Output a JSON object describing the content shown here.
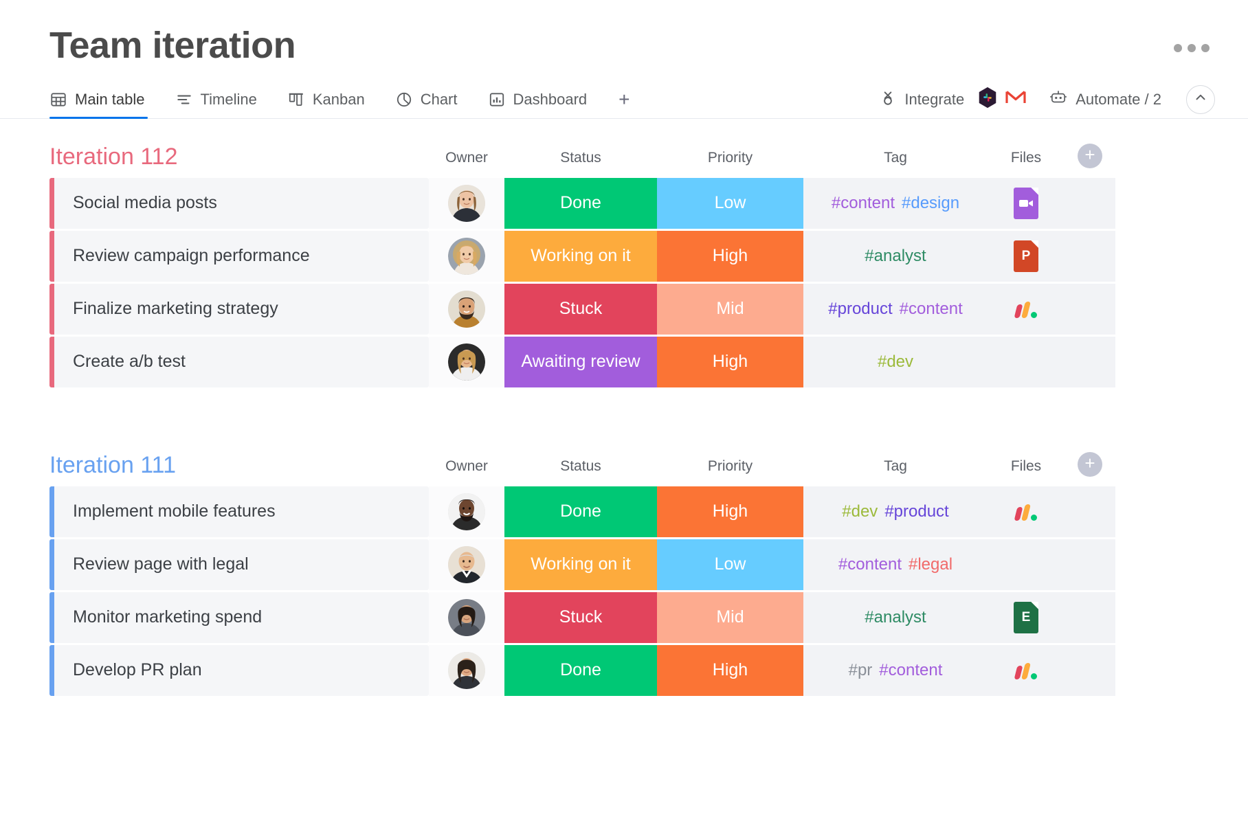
{
  "header": {
    "title": "Team iteration",
    "overflow_menu": "..."
  },
  "tabs": [
    {
      "label": "Main table",
      "icon": "table-icon",
      "active": true
    },
    {
      "label": "Timeline",
      "icon": "timeline-icon",
      "active": false
    },
    {
      "label": "Kanban",
      "icon": "kanban-icon",
      "active": false
    },
    {
      "label": "Chart",
      "icon": "chart-pie-icon",
      "active": false
    },
    {
      "label": "Dashboard",
      "icon": "dashboard-bars-icon",
      "active": false
    }
  ],
  "add_view_label": "+",
  "tools": {
    "integrate_label": "Integrate",
    "automate_label": "Automate / 2",
    "integration_apps": [
      "slack-icon",
      "gmail-icon"
    ],
    "collapse_label": "chevron-up-icon"
  },
  "columns": [
    "Owner",
    "Status",
    "Priority",
    "Tag",
    "Files"
  ],
  "add_column_label": "+",
  "colors": {
    "done": "#00c875",
    "working_on_it": "#fdab3d",
    "stuck": "#e2445c",
    "awaiting_review": "#a25ddc",
    "high": "#fb7435",
    "mid": "#fdab8f",
    "low": "#66ccff",
    "group_112": "#e8697d",
    "group_111": "#68a1f0",
    "tag_content": "#a25ddc",
    "tag_design": "#579bfc",
    "tag_analyst": "#2e8b64",
    "tag_product": "#6645d9",
    "tag_dev": "#9cba3b",
    "tag_legal": "#f16a6a",
    "tag_pr": "#8a8f98",
    "accent": "#0073ea"
  },
  "groups": [
    {
      "title": "Iteration 112",
      "color": "#e8697d",
      "rows": [
        {
          "name": "Social media posts",
          "owner": "avatar-woman-blonde",
          "status": "Done",
          "status_color": "#00c875",
          "priority": "Low",
          "priority_color": "#66ccff",
          "tags": [
            {
              "text": "#content",
              "color": "#a25ddc"
            },
            {
              "text": "#design",
              "color": "#579bfc"
            }
          ],
          "file": {
            "type": "video-file-icon",
            "color": "#a25ddc",
            "label": ""
          }
        },
        {
          "name": "Review campaign performance",
          "owner": "avatar-woman-curly",
          "status": "Working on it",
          "status_color": "#fdab3d",
          "priority": "High",
          "priority_color": "#fb7435",
          "tags": [
            {
              "text": "#analyst",
              "color": "#2e8b64"
            }
          ],
          "file": {
            "type": "powerpoint-file-icon",
            "color": "#d24726",
            "label": "P"
          }
        },
        {
          "name": "Finalize marketing strategy",
          "owner": "avatar-man-beard",
          "status": "Stuck",
          "status_color": "#e2445c",
          "priority": "Mid",
          "priority_color": "#fdab8f",
          "tags": [
            {
              "text": "#product",
              "color": "#6645d9"
            },
            {
              "text": "#content",
              "color": "#a25ddc"
            }
          ],
          "file": {
            "type": "monday-logo-icon",
            "color": "",
            "label": ""
          }
        },
        {
          "name": "Create a/b test",
          "owner": "avatar-woman-long-hair",
          "status": "Awaiting review",
          "status_color": "#a25ddc",
          "priority": "High",
          "priority_color": "#fb7435",
          "tags": [
            {
              "text": "#dev",
              "color": "#9cba3b"
            }
          ],
          "file": null
        }
      ]
    },
    {
      "title": "Iteration 111",
      "color": "#68a1f0",
      "rows": [
        {
          "name": "Implement mobile features",
          "owner": "avatar-man-dark-beard",
          "status": "Done",
          "status_color": "#00c875",
          "priority": "High",
          "priority_color": "#fb7435",
          "tags": [
            {
              "text": "#dev",
              "color": "#9cba3b"
            },
            {
              "text": "#product",
              "color": "#6645d9"
            }
          ],
          "file": {
            "type": "monday-logo-icon",
            "color": "",
            "label": ""
          }
        },
        {
          "name": "Review page with legal",
          "owner": "avatar-man-bald",
          "status": "Working on it",
          "status_color": "#fdab3d",
          "priority": "Low",
          "priority_color": "#66ccff",
          "tags": [
            {
              "text": "#content",
              "color": "#a25ddc"
            },
            {
              "text": "#legal",
              "color": "#f16a6a"
            }
          ],
          "file": null
        },
        {
          "name": "Monitor marketing spend",
          "owner": "avatar-woman-dark-hair",
          "status": "Stuck",
          "status_color": "#e2445c",
          "priority": "Mid",
          "priority_color": "#fdab8f",
          "tags": [
            {
              "text": "#analyst",
              "color": "#2e8b64"
            }
          ],
          "file": {
            "type": "excel-file-icon",
            "color": "#1e7145",
            "label": "E"
          }
        },
        {
          "name": "Develop PR plan",
          "owner": "avatar-woman-dark-straight",
          "status": "Done",
          "status_color": "#00c875",
          "priority": "High",
          "priority_color": "#fb7435",
          "tags": [
            {
              "text": "#pr",
              "color": "#8a8f98"
            },
            {
              "text": "#content",
              "color": "#a25ddc"
            }
          ],
          "file": {
            "type": "monday-logo-icon",
            "color": "",
            "label": ""
          }
        }
      ]
    }
  ]
}
